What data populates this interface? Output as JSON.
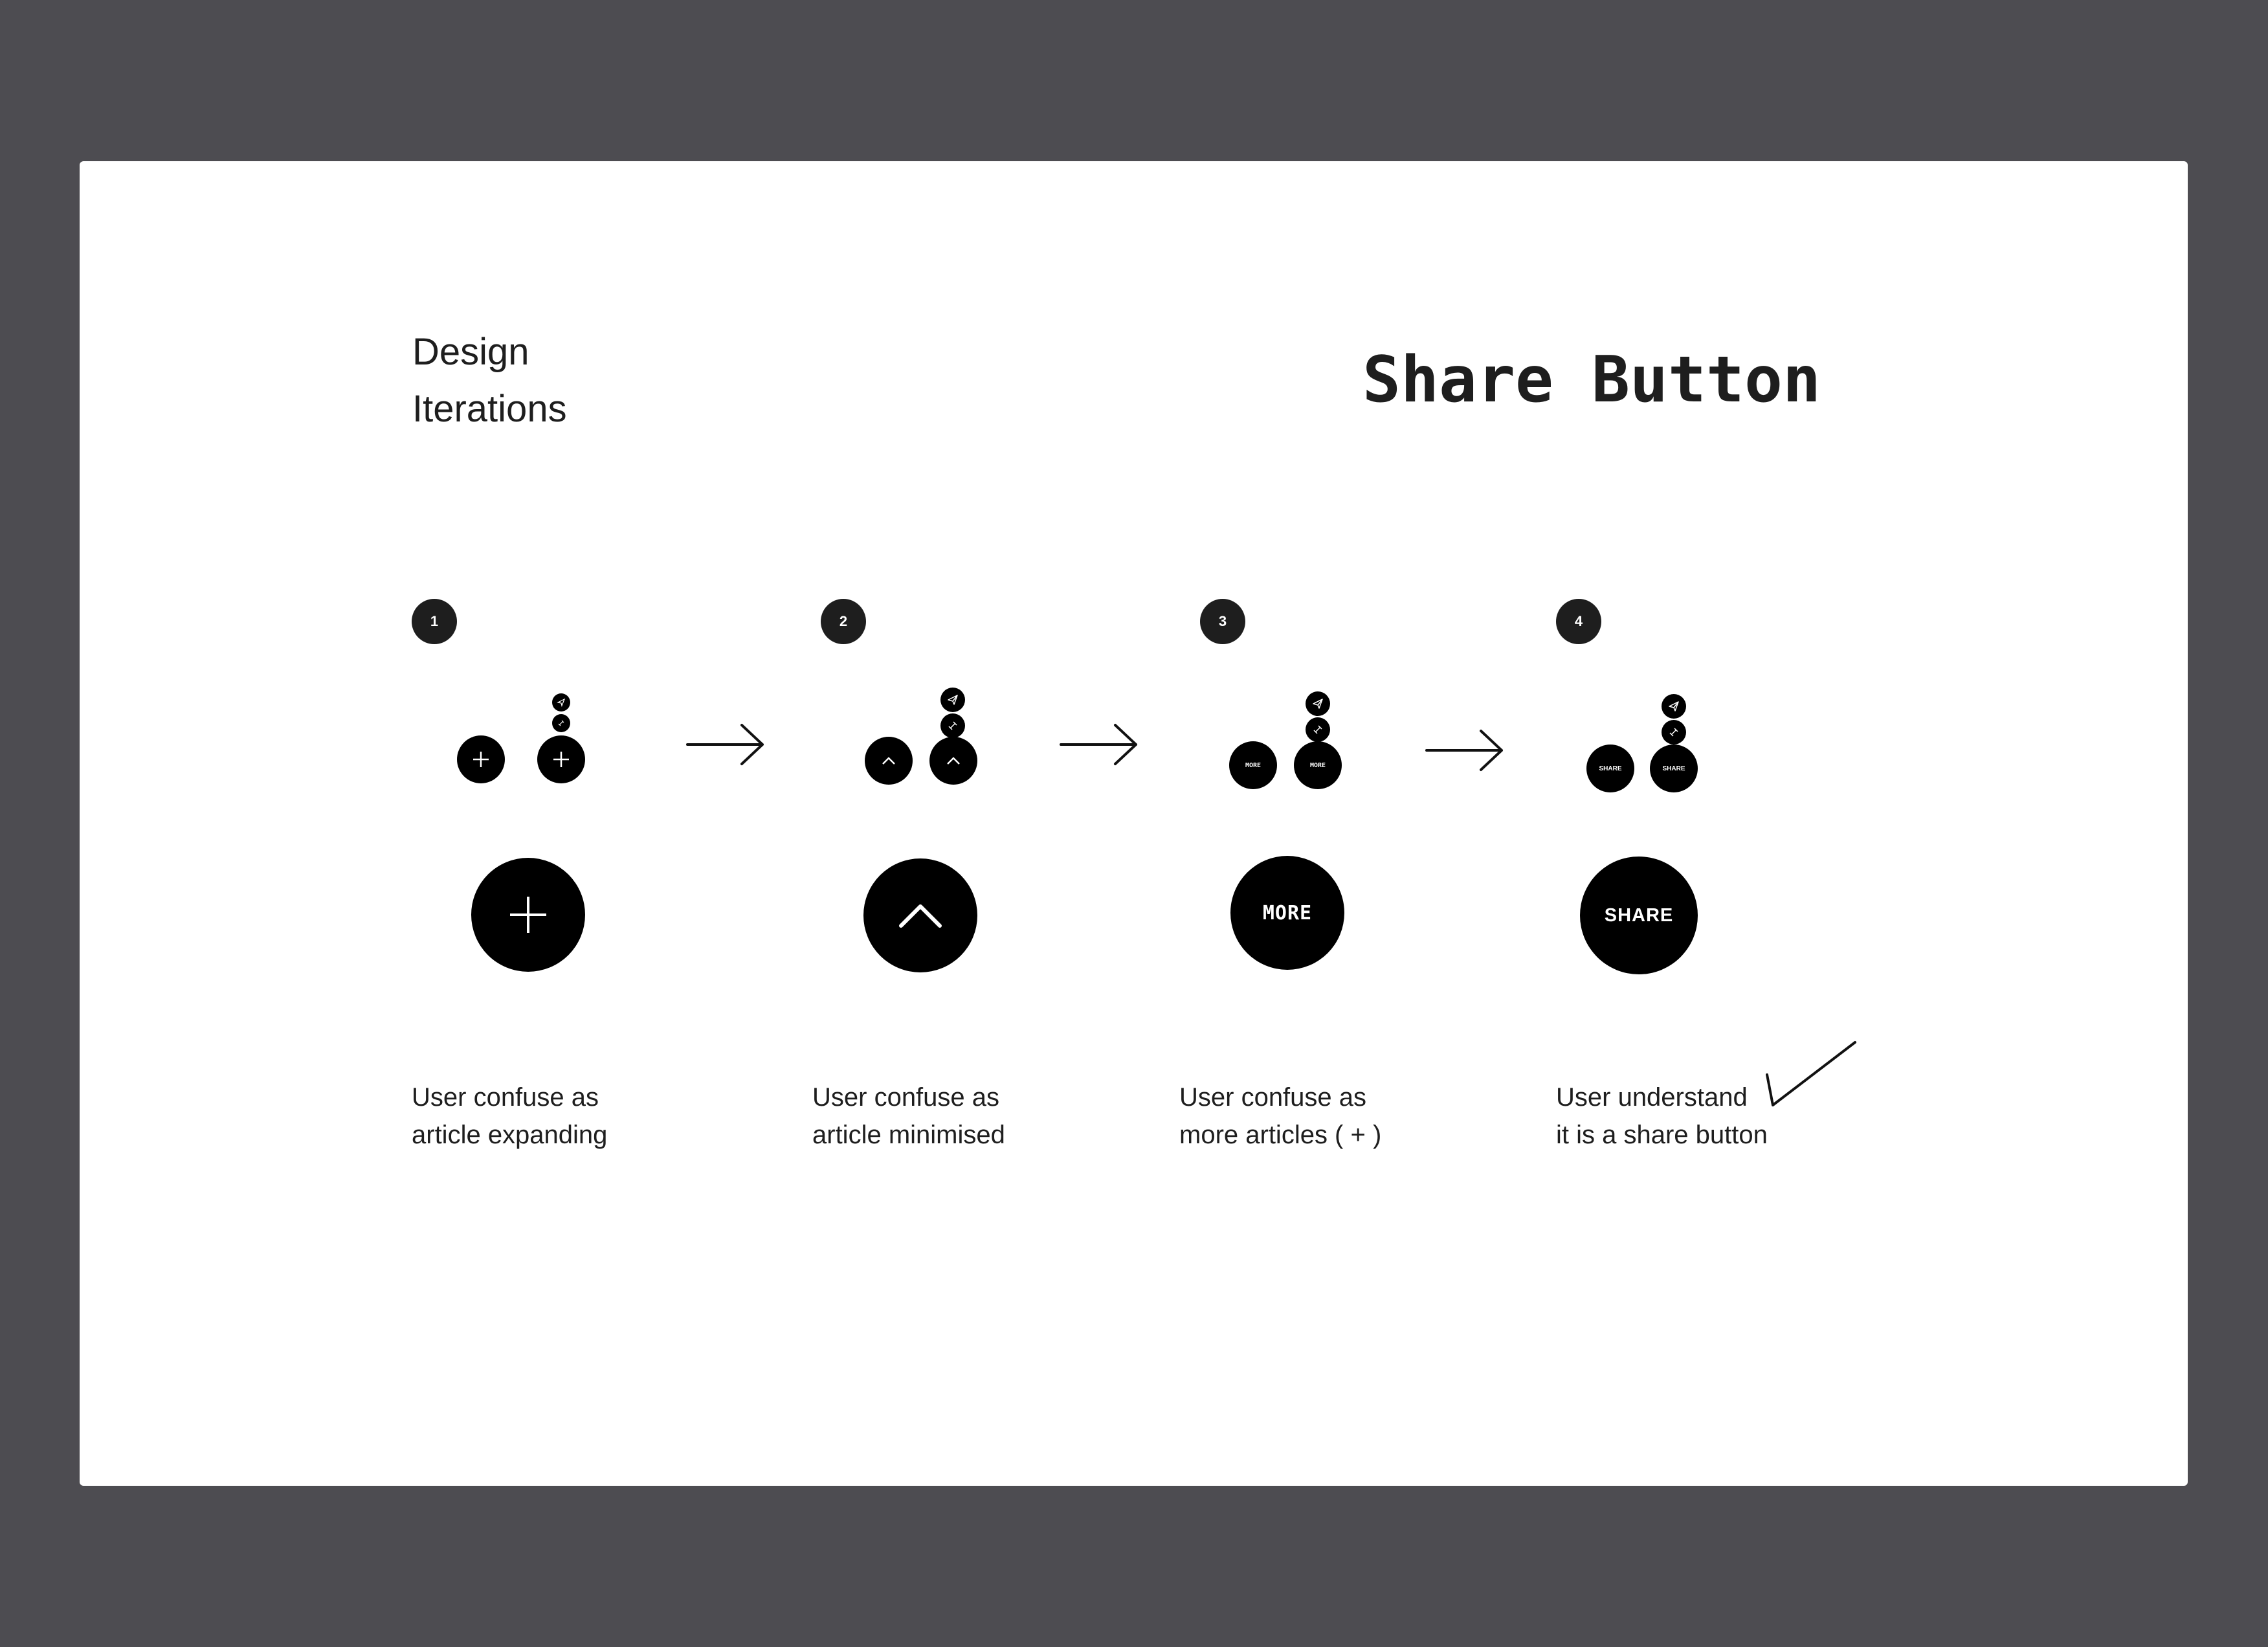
{
  "heading": {
    "line1": "Design",
    "line2": "Iterations"
  },
  "title": "Share Button",
  "steps": [
    {
      "number": "1",
      "icon": "plus-icon",
      "caption_line1": "User confuse as",
      "caption_line2": "article expanding"
    },
    {
      "number": "2",
      "icon": "chevron-up-icon",
      "caption_line1": "User confuse as",
      "caption_line2": "article minimised"
    },
    {
      "number": "3",
      "label": "MORE",
      "caption_line1": "User confuse as",
      "caption_line2": "more articles ( + )"
    },
    {
      "number": "4",
      "label": "SHARE",
      "caption_line1": "User understand",
      "caption_line2": "it is a share button"
    }
  ],
  "colors": {
    "background": "#4d4c51",
    "canvas": "#ffffff",
    "button": "#000000",
    "badge": "#1e1e1e",
    "text": "#1e1e1e"
  },
  "icons": {
    "arrow": "arrow-right-icon",
    "check": "checkmark-icon",
    "send": "send-icon",
    "link": "link-icon"
  }
}
